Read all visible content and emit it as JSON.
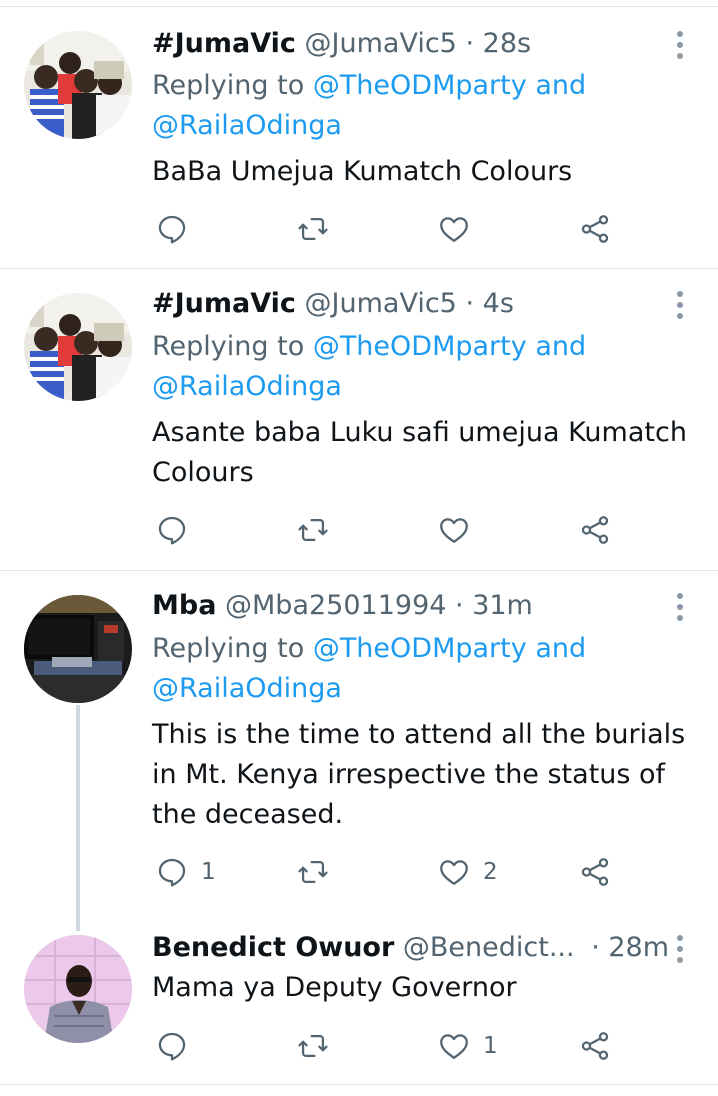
{
  "tweets": [
    {
      "name": "#JumaVic",
      "handle": "@JumaVic5",
      "separator": "·",
      "time": "28s",
      "replying_prefix": "Replying to",
      "mention1": "@TheODMparty",
      "and": "and",
      "mention2": "@RailaOdinga",
      "text_lines": [
        "BaBa Umejua Kumatch Colours"
      ],
      "reply_count": "",
      "retweet_count": "",
      "like_count": ""
    },
    {
      "name": "#JumaVic",
      "handle": "@JumaVic5",
      "separator": "·",
      "time": "4s",
      "replying_prefix": "Replying to",
      "mention1": "@TheODMparty",
      "and": "and",
      "mention2": "@RailaOdinga",
      "text_lines": [
        "Asante baba Luku safi umejua Kumatch",
        "Colours"
      ],
      "reply_count": "",
      "retweet_count": "",
      "like_count": ""
    },
    {
      "name": "Mba",
      "handle": "@Mba25011994",
      "separator": "·",
      "time": "31m",
      "replying_prefix": "Replying to",
      "mention1": "@TheODMparty",
      "and": "and",
      "mention2": "@RailaOdinga",
      "text_lines": [
        "This is the time to attend all the burials",
        "in Mt. Kenya irrespective the status of",
        "the deceased."
      ],
      "reply_count": "1",
      "retweet_count": "",
      "like_count": "2"
    },
    {
      "name": "Benedict Owuor",
      "handle": "@Benedict...",
      "separator": "·",
      "time": "28m",
      "text_lines": [
        "Mama ya Deputy Governor"
      ],
      "reply_count": "",
      "retweet_count": "",
      "like_count": "1"
    }
  ],
  "icons": {
    "reply": "reply-icon",
    "retweet": "retweet-icon",
    "like": "heart-icon",
    "share": "share-icon",
    "more": "more-options-icon"
  },
  "colors": {
    "link": "#1d9bf0",
    "secondary_text": "#536471",
    "primary_text": "#0f1419",
    "divider": "#e1e8ed"
  }
}
